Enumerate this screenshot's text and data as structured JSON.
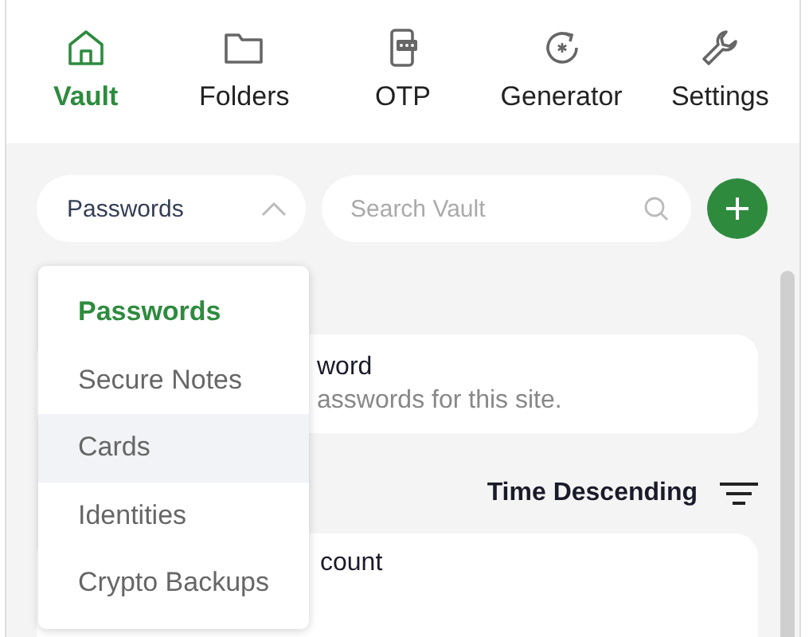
{
  "nav": [
    {
      "label": "Vault",
      "selected": true
    },
    {
      "label": "Folders",
      "selected": false
    },
    {
      "label": "OTP",
      "selected": false
    },
    {
      "label": "Generator",
      "selected": false
    },
    {
      "label": "Settings",
      "selected": false
    }
  ],
  "type_dropdown": {
    "value": "Passwords",
    "expanded": true
  },
  "search": {
    "placeholder": "Search Vault"
  },
  "menu": [
    {
      "label": "Passwords",
      "selected": true,
      "highlighted": false
    },
    {
      "label": "Secure Notes",
      "selected": false,
      "highlighted": false
    },
    {
      "label": "Cards",
      "selected": false,
      "highlighted": true
    },
    {
      "label": "Identities",
      "selected": false,
      "highlighted": false
    },
    {
      "label": "Crypto Backups",
      "selected": false,
      "highlighted": false
    }
  ],
  "notice_card": {
    "title": "word",
    "text": "asswords for this site."
  },
  "sort": {
    "label": "Time Descending"
  },
  "items": [
    {
      "title": "count"
    }
  ]
}
